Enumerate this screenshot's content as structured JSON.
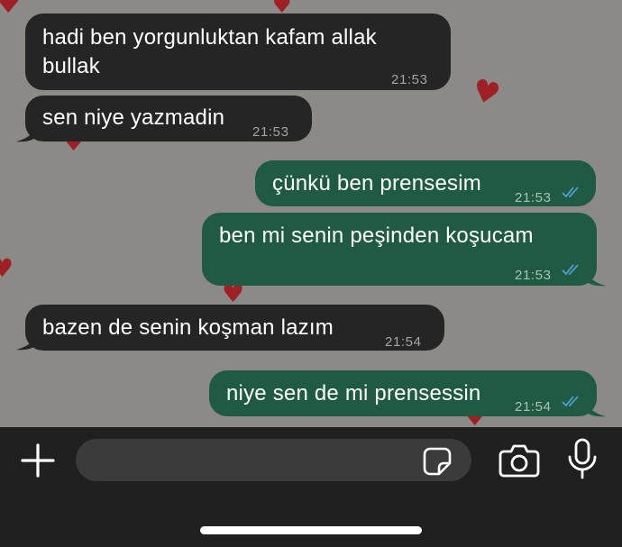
{
  "messages": [
    {
      "direction": "incoming",
      "text": "hadi ben yorgunluktan kafam allak\nbullak",
      "time": "21:53"
    },
    {
      "direction": "incoming",
      "text": "sen niye yazmadin",
      "time": "21:53"
    },
    {
      "direction": "outgoing",
      "text": "çünkü ben prensesim",
      "time": "21:53",
      "status": "read"
    },
    {
      "direction": "outgoing",
      "text": "ben mi senin peşinden koşucam",
      "time": "21:53",
      "status": "read"
    },
    {
      "direction": "incoming",
      "text": "bazen de senin koşman lazım",
      "time": "21:54"
    },
    {
      "direction": "outgoing",
      "text": "niye sen de mi prensessin",
      "time": "21:54",
      "status": "read"
    }
  ],
  "composer": {
    "input_value": "",
    "icons": [
      "plus-icon",
      "sticker-icon",
      "camera-icon",
      "microphone-icon"
    ]
  },
  "colors": {
    "chat_background": "#8c8a86",
    "incoming_bubble": "#252525",
    "outgoing_bubble": "#1f5b43",
    "read_ticks": "#53a4e6",
    "wallpaper_hearts": "#9e1f24",
    "composer_bar": "#202020"
  }
}
